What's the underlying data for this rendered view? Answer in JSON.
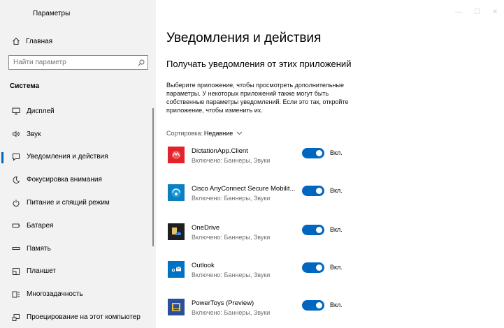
{
  "window": {
    "title": "Параметры",
    "controls": [
      "—",
      "☐",
      "✕"
    ]
  },
  "sidebar": {
    "home_label": "Главная",
    "search_placeholder": "Найти параметр",
    "section_title": "Система",
    "items": [
      {
        "label": "Дисплей",
        "icon": "display-icon"
      },
      {
        "label": "Звук",
        "icon": "speaker-icon"
      },
      {
        "label": "Уведомления и действия",
        "icon": "notification-icon",
        "active": true
      },
      {
        "label": "Фокусировка внимания",
        "icon": "moon-icon"
      },
      {
        "label": "Питание и спящий режим",
        "icon": "power-icon"
      },
      {
        "label": "Батарея",
        "icon": "battery-icon"
      },
      {
        "label": "Память",
        "icon": "storage-icon"
      },
      {
        "label": "Планшет",
        "icon": "tablet-icon"
      },
      {
        "label": "Многозадачность",
        "icon": "multitasking-icon"
      },
      {
        "label": "Проецирование на этот компьютер",
        "icon": "projecting-icon"
      }
    ]
  },
  "main": {
    "title": "Уведомления и действия",
    "subtitle": "Получать уведомления от этих приложений",
    "description": "Выберите приложение, чтобы просмотреть дополнительные параметры. У некоторых приложений также могут быть собственные параметры уведомлений. Если это так, откройте приложение, чтобы изменить их.",
    "sort_label": "Сортировка:",
    "sort_value": "Недавние",
    "apps": [
      {
        "name": "DictationApp.Client",
        "status": "Включено: Баннеры, Звуки",
        "toggle": "Вкл.",
        "on": true,
        "icon": "dictation-app-icon",
        "color": "#e3232c"
      },
      {
        "name": "Cisco AnyConnect Secure Mobilit...",
        "status": "Включено: Баннеры, Звуки",
        "toggle": "Вкл.",
        "on": true,
        "icon": "cisco-anyconnect-icon",
        "color": "#0d7fbf"
      },
      {
        "name": "OneDrive",
        "status": "Включено: Баннеры, Звуки",
        "toggle": "Вкл.",
        "on": true,
        "icon": "onedrive-icon",
        "color": "#1f1f1f"
      },
      {
        "name": "Outlook",
        "status": "Включено: Баннеры, Звуки",
        "toggle": "Вкл.",
        "on": true,
        "icon": "outlook-icon",
        "color": "#0072c6"
      },
      {
        "name": "PowerToys (Preview)",
        "status": "Включено: Баннеры, Звуки",
        "toggle": "Вкл.",
        "on": true,
        "icon": "powertoys-icon",
        "color": "#2a4f9c"
      }
    ]
  },
  "colors": {
    "accent": "#0067c0",
    "sidebar_bg": "#f2f2f2"
  }
}
